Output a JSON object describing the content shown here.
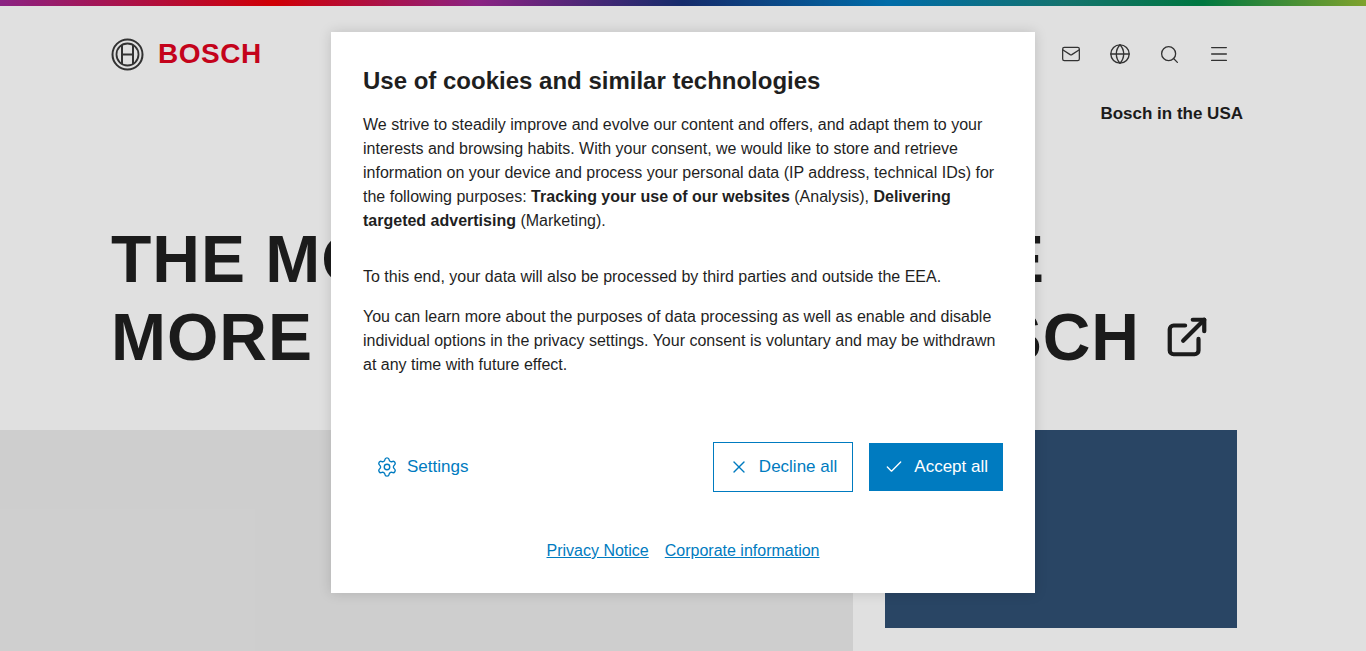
{
  "header": {
    "logo": "BOSCH",
    "region_link": "Bosch in the USA"
  },
  "headline": {
    "lines": [
      {
        "left": "THE MO",
        "right": "E"
      },
      {
        "left": "MORE",
        "right": "SCH"
      }
    ]
  },
  "cookie_dialog": {
    "title": "Use of cookies and similar technologies",
    "intro": [
      {
        "text": "We strive to steadily improve and evolve our content and offers, and adapt them to your interests and browsing habits. With your consent, we would like to store and retrieve information on your device and process your personal data (IP address, technical IDs) for the following purposes: ",
        "bold": false
      },
      {
        "text": "Tracking your use of our websites",
        "bold": true
      },
      {
        "text": " (Analysis), ",
        "bold": false
      },
      {
        "text": "Delivering targeted advertising",
        "bold": true
      },
      {
        "text": " (Marketing).",
        "bold": false
      }
    ],
    "paragraphs": [
      "To this end, your data will also be processed by third parties and outside the EEA.",
      "You can learn more about the purposes of data processing as well as enable and disable individual options in the privacy settings. Your consent is voluntary and may be withdrawn at any time with future effect."
    ],
    "settings_button": "Settings",
    "decline_button": "Decline all",
    "accept_button": "Accept all",
    "links": [
      "Privacy Notice",
      "Corporate information"
    ]
  }
}
